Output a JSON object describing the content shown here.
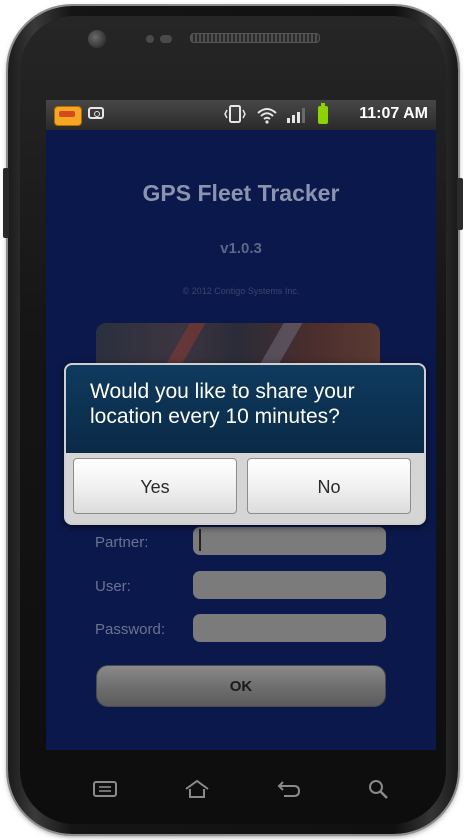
{
  "status_bar": {
    "time": "11:07 AM",
    "icons": [
      "app-notification-icon",
      "camera-icon",
      "vibrate-icon",
      "wifi-icon",
      "signal-icon",
      "battery-icon"
    ],
    "battery_color": "#8bd400"
  },
  "app": {
    "title": "GPS Fleet Tracker",
    "version": "v1.0.3",
    "copyright": "© 2012 Contigo Systems Inc.",
    "background_color": "#0b184b"
  },
  "form": {
    "partner_label": "Partner:",
    "user_label": "User:",
    "password_label": "Password:",
    "partner_value": "",
    "user_value": "",
    "password_value": "",
    "ok_label": "OK"
  },
  "dialog": {
    "message": "Would you like to share your location every 10 minutes?",
    "yes_label": "Yes",
    "no_label": "No"
  },
  "nav_bar": {
    "icons": [
      "menu-icon",
      "home-icon",
      "back-icon",
      "search-icon"
    ]
  }
}
